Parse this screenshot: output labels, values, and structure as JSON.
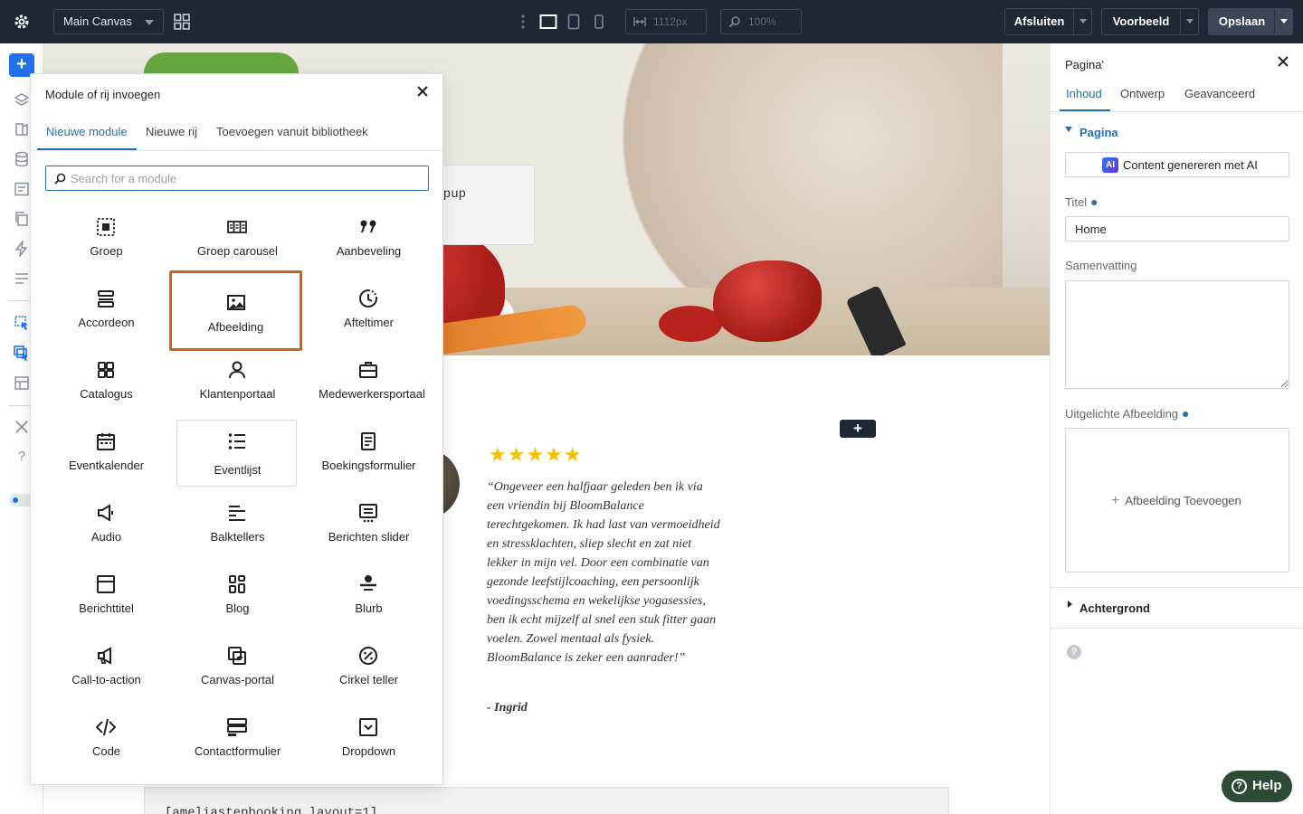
{
  "toolbar": {
    "canvas_select": "Main Canvas",
    "width_value": "1112px",
    "zoom_value": "100%",
    "exit_label": "Afsluiten",
    "preview_label": "Voorbeeld",
    "save_label": "Opslaan"
  },
  "canvas": {
    "popup_text": "oopup",
    "testimonial_stars": "★★★★★",
    "testimonial_quote": "“Ongeveer een halfjaar geleden ben ik via een vriendin bij BloomBalance terechtgekomen. Ik had last van vermoeidheid en stressklachten, sliep slecht en zat niet lekker in mijn vel. Door een combinatie van gezonde leefstijlcoaching, een persoonlijk voedingsschema en wekelijkse yogasessies, ben ik echt mijzelf al snel een stuk fitter gaan voelen. Zowel mentaal als fysiek. BloomBalance is zeker een aanrader!”",
    "testimonial_author": "- Ingrid",
    "shortcode_text": "[ameliastepbooking layout=1]",
    "add_row_symbol": "+"
  },
  "modal": {
    "title": "Module of rij invoegen",
    "tabs": [
      "Nieuwe module",
      "Nieuwe rij",
      "Toevoegen vanuit bibliotheek"
    ],
    "search_placeholder": "Search for a module",
    "modules": [
      {
        "label": "Groep",
        "icon": "group-icon"
      },
      {
        "label": "Groep carousel",
        "icon": "group-carousel-icon"
      },
      {
        "label": "Aanbeveling",
        "icon": "quote-icon"
      },
      {
        "label": "Accordeon",
        "icon": "accordion-icon"
      },
      {
        "label": "Afbeelding",
        "icon": "image-icon"
      },
      {
        "label": "Afteltimer",
        "icon": "countdown-icon"
      },
      {
        "label": "Catalogus",
        "icon": "catalog-icon"
      },
      {
        "label": "Klantenportaal",
        "icon": "user-icon"
      },
      {
        "label": "Medewerkersportaal",
        "icon": "briefcase-icon"
      },
      {
        "label": "Eventkalender",
        "icon": "calendar-icon"
      },
      {
        "label": "Eventlijst",
        "icon": "list-icon"
      },
      {
        "label": "Boekingsformulier",
        "icon": "form-icon"
      },
      {
        "label": "Audio",
        "icon": "speaker-icon"
      },
      {
        "label": "Balktellers",
        "icon": "bar-counter-icon"
      },
      {
        "label": "Berichten slider",
        "icon": "post-slider-icon"
      },
      {
        "label": "Berichttitel",
        "icon": "post-title-icon"
      },
      {
        "label": "Blog",
        "icon": "blog-icon"
      },
      {
        "label": "Blurb",
        "icon": "blurb-icon"
      },
      {
        "label": "Call-to-action",
        "icon": "megaphone-icon"
      },
      {
        "label": "Canvas-portal",
        "icon": "canvas-portal-icon"
      },
      {
        "label": "Cirkel teller",
        "icon": "circle-counter-icon"
      },
      {
        "label": "Code",
        "icon": "code-icon"
      },
      {
        "label": "Contactformulier",
        "icon": "contact-form-icon"
      },
      {
        "label": "Dropdown",
        "icon": "dropdown-icon"
      }
    ]
  },
  "panel": {
    "title": "Pagina'",
    "tabs": [
      "Inhoud",
      "Ontwerp",
      "Geavanceerd"
    ],
    "section_page": "Pagina",
    "ai_button": "Content genereren met AI",
    "ai_badge": "AI",
    "title_label": "Titel",
    "title_value": "Home",
    "summary_label": "Samenvatting",
    "summary_value": "",
    "featured_label": "Uitgelichte Afbeelding",
    "add_image_label": "Afbeelding Toevoegen",
    "section_background": "Achtergrond"
  },
  "help": {
    "label": "Help"
  }
}
